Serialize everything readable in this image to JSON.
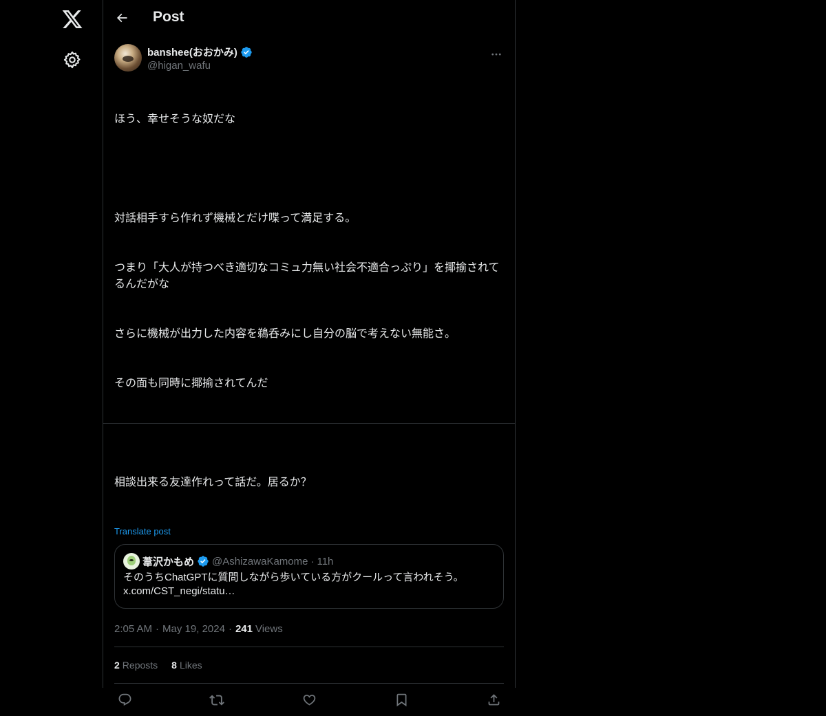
{
  "icons": {
    "logo": "x-logo-icon",
    "settings": "gear-icon",
    "back": "arrow-left-icon",
    "verified": "verified-badge-icon",
    "more": "more-horizontal-icon",
    "reply": "reply-icon",
    "repost": "repost-icon",
    "like": "heart-icon",
    "bookmark": "bookmark-icon",
    "share": "share-icon"
  },
  "colors": {
    "background": "#000000",
    "text": "#e7e9ea",
    "secondary": "#71767b",
    "accent": "#1d9bf0",
    "border": "#2f3336"
  },
  "header": {
    "title": "Post"
  },
  "post": {
    "author": {
      "name": "banshee(おおかみ)",
      "handle": "@higan_wafu"
    },
    "lines": [
      "ほう、幸せそうな奴だな",
      "",
      "対話相手すら作れず機械とだけ喋って満足する。",
      "つまり「大人が持つべき適切なコミュ力無い社会不適合っぷり」を揶揄されてるんだがな",
      "さらに機械が出力した内容を鵜呑みにし自分の脳で考えない無能さ。",
      "その面も同時に揶揄されてんだ",
      "",
      "相談出来る友達作れって話だ。居るか？"
    ],
    "translate": "Translate post",
    "quote": {
      "name": "葦沢かもめ",
      "handle": "@AshizawaKamome",
      "dot": "·",
      "time": "11h",
      "text_line1": "そのうちChatGPTに質問しながら歩いている方がクールって言われそう。",
      "text_line2": "x.com/CST_negi/statu…"
    },
    "time": "2:05 AM",
    "sep1": "·",
    "date": "May 19, 2024",
    "sep2": "·",
    "views_count": "241",
    "views_label": "Views",
    "reposts_count": "2",
    "reposts_label": "Reposts",
    "likes_count": "8",
    "likes_label": "Likes"
  }
}
